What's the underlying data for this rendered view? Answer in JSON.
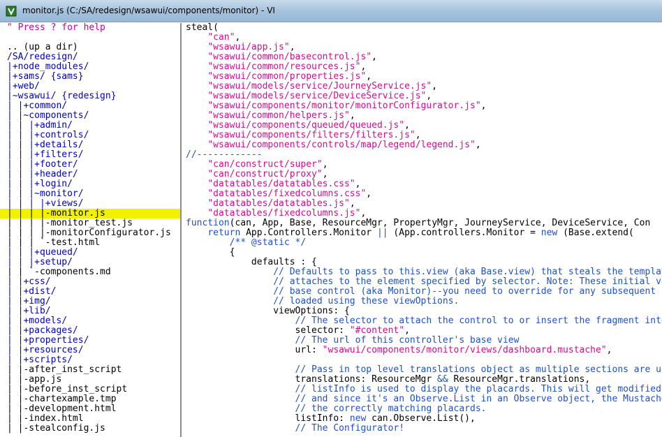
{
  "window": {
    "title": "monitor.js (C:/SA/redesign/wsawui/components/monitor) - VI"
  },
  "file_tree": {
    "lines": [
      {
        "text": "\" Press ? for help",
        "type": "help"
      },
      {
        "text": "",
        "type": "file"
      },
      {
        "text": ".. (up a dir)",
        "type": "file"
      },
      {
        "text": "/SA/redesign/",
        "type": "dir"
      },
      {
        "text": "|+node_modules/",
        "type": "dir"
      },
      {
        "text": "|+sams/ {sams}",
        "type": "dir"
      },
      {
        "text": "|+web/",
        "type": "dir"
      },
      {
        "text": "|~wsawui/ {redesign}",
        "type": "dir"
      },
      {
        "text": "| |+common/",
        "type": "dir"
      },
      {
        "text": "| |~components/",
        "type": "dir"
      },
      {
        "text": "| | |+admin/",
        "type": "dir"
      },
      {
        "text": "| | |+controls/",
        "type": "dir"
      },
      {
        "text": "| | |+details/",
        "type": "dir"
      },
      {
        "text": "| | |+filters/",
        "type": "dir"
      },
      {
        "text": "| | |+footer/",
        "type": "dir"
      },
      {
        "text": "| | |+header/",
        "type": "dir"
      },
      {
        "text": "| | |+login/",
        "type": "dir"
      },
      {
        "text": "| | |~monitor/",
        "type": "dir"
      },
      {
        "text": "| | | |+views/",
        "type": "dir"
      },
      {
        "text": "| | | |-monitor.js",
        "type": "selected"
      },
      {
        "text": "| | | |-monitor_test.js",
        "type": "file"
      },
      {
        "text": "| | | |-monitorConfigurator.js",
        "type": "file"
      },
      {
        "text": "| | | `-test.html",
        "type": "file"
      },
      {
        "text": "| | |+queued/",
        "type": "dir"
      },
      {
        "text": "| | |+setup/",
        "type": "dir"
      },
      {
        "text": "| | `-components.md",
        "type": "file"
      },
      {
        "text": "| |+css/",
        "type": "dir"
      },
      {
        "text": "| |+dist/",
        "type": "dir"
      },
      {
        "text": "| |+img/",
        "type": "dir"
      },
      {
        "text": "| |+lib/",
        "type": "dir"
      },
      {
        "text": "| |+models/",
        "type": "dir"
      },
      {
        "text": "| |+packages/",
        "type": "dir"
      },
      {
        "text": "| |+properties/",
        "type": "dir"
      },
      {
        "text": "| |+resources/",
        "type": "dir"
      },
      {
        "text": "| |+scripts/",
        "type": "dir"
      },
      {
        "text": "| |-after_inst_script",
        "type": "file"
      },
      {
        "text": "| |-app.js",
        "type": "file"
      },
      {
        "text": "| |-before_inst_script",
        "type": "file"
      },
      {
        "text": "| |-chartexample.tmp",
        "type": "file"
      },
      {
        "text": "| |-development.html",
        "type": "file"
      },
      {
        "text": "| |-index.html",
        "type": "file"
      },
      {
        "text": "| |-stealconfig.js",
        "type": "file"
      }
    ]
  },
  "code": {
    "lines": [
      [
        {
          "t": "steal(",
          "c": "text"
        }
      ],
      [
        {
          "t": "    ",
          "c": "text"
        },
        {
          "t": "\"can\"",
          "c": "str"
        },
        {
          "t": ",",
          "c": "text"
        }
      ],
      [
        {
          "t": "    ",
          "c": "text"
        },
        {
          "t": "\"wsawui/app.js\"",
          "c": "str"
        },
        {
          "t": ",",
          "c": "text"
        }
      ],
      [
        {
          "t": "    ",
          "c": "text"
        },
        {
          "t": "\"wsawui/common/basecontrol.js\"",
          "c": "str"
        },
        {
          "t": ",",
          "c": "text"
        }
      ],
      [
        {
          "t": "    ",
          "c": "text"
        },
        {
          "t": "\"wsawui/common/resources.js\"",
          "c": "str"
        },
        {
          "t": ",",
          "c": "text"
        }
      ],
      [
        {
          "t": "    ",
          "c": "text"
        },
        {
          "t": "\"wsawui/common/properties.js\"",
          "c": "str"
        },
        {
          "t": ",",
          "c": "text"
        }
      ],
      [
        {
          "t": "    ",
          "c": "text"
        },
        {
          "t": "\"wsawui/models/service/JourneyService.js\"",
          "c": "str"
        },
        {
          "t": ",",
          "c": "text"
        }
      ],
      [
        {
          "t": "    ",
          "c": "text"
        },
        {
          "t": "\"wsawui/models/service/DeviceService.js\"",
          "c": "str"
        },
        {
          "t": ",",
          "c": "text"
        }
      ],
      [
        {
          "t": "    ",
          "c": "text"
        },
        {
          "t": "\"wsawui/components/monitor/monitorConfigurator.js\"",
          "c": "str"
        },
        {
          "t": ",",
          "c": "text"
        }
      ],
      [
        {
          "t": "    ",
          "c": "text"
        },
        {
          "t": "\"wsawui/common/helpers.js\"",
          "c": "str"
        },
        {
          "t": ",",
          "c": "text"
        }
      ],
      [
        {
          "t": "    ",
          "c": "text"
        },
        {
          "t": "\"wsawui/components/queued/queued.js\"",
          "c": "str"
        },
        {
          "t": ",",
          "c": "text"
        }
      ],
      [
        {
          "t": "    ",
          "c": "text"
        },
        {
          "t": "\"wsawui/components/filters/filters.js\"",
          "c": "str"
        },
        {
          "t": ",",
          "c": "text"
        }
      ],
      [
        {
          "t": "    ",
          "c": "text"
        },
        {
          "t": "\"wsawui/components/controls/map/legend/legend.js\"",
          "c": "str"
        },
        {
          "t": ",",
          "c": "text"
        }
      ],
      [
        {
          "t": "//------------",
          "c": "com"
        }
      ],
      [
        {
          "t": "    ",
          "c": "text"
        },
        {
          "t": "\"can/construct/super\"",
          "c": "str"
        },
        {
          "t": ",",
          "c": "text"
        }
      ],
      [
        {
          "t": "    ",
          "c": "text"
        },
        {
          "t": "\"can/construct/proxy\"",
          "c": "str"
        },
        {
          "t": ",",
          "c": "text"
        }
      ],
      [
        {
          "t": "    ",
          "c": "text"
        },
        {
          "t": "\"datatables/datatables.css\"",
          "c": "str"
        },
        {
          "t": ",",
          "c": "text"
        }
      ],
      [
        {
          "t": "    ",
          "c": "text"
        },
        {
          "t": "\"datatables/fixedcolumns.css\"",
          "c": "str"
        },
        {
          "t": ",",
          "c": "text"
        }
      ],
      [
        {
          "t": "    ",
          "c": "text"
        },
        {
          "t": "\"datatables/datatables.js\"",
          "c": "str"
        },
        {
          "t": ",",
          "c": "text"
        }
      ],
      [
        {
          "t": "    ",
          "c": "text"
        },
        {
          "t": "\"datatables/fixedcolumns.js\"",
          "c": "str"
        },
        {
          "t": ",",
          "c": "text"
        }
      ],
      [
        {
          "t": "function",
          "c": "kw"
        },
        {
          "t": "(can, App, Base, ResourceMgr, PropertyMgr, JourneyService, DeviceService, Con",
          "c": "text"
        }
      ],
      [
        {
          "t": "    ",
          "c": "text"
        },
        {
          "t": "return",
          "c": "kw"
        },
        {
          "t": " App.Controllers.Monitor ",
          "c": "text"
        },
        {
          "t": "||",
          "c": "kw"
        },
        {
          "t": " (App.controllers.Monitor = ",
          "c": "text"
        },
        {
          "t": "new",
          "c": "kw"
        },
        {
          "t": " (Base.extend(",
          "c": "text"
        }
      ],
      [
        {
          "t": "        ",
          "c": "text"
        },
        {
          "t": "/** @static */",
          "c": "com"
        }
      ],
      [
        {
          "t": "        {",
          "c": "text"
        }
      ],
      [
        {
          "t": "            defaults : {",
          "c": "text"
        }
      ],
      [
        {
          "t": "                ",
          "c": "text"
        },
        {
          "t": "// Defaults to pass to this.view (aka Base.view) that steals the template",
          "c": "com"
        }
      ],
      [
        {
          "t": "                ",
          "c": "text"
        },
        {
          "t": "// attaches to the element specified by selector. Note: These initial val",
          "c": "com"
        }
      ],
      [
        {
          "t": "                ",
          "c": "text"
        },
        {
          "t": "// base control (aka Monitor)--you need to override for any subsequent \"s",
          "c": "com"
        }
      ],
      [
        {
          "t": "                ",
          "c": "text"
        },
        {
          "t": "// loaded using these viewOptions.",
          "c": "com"
        }
      ],
      [
        {
          "t": "                viewOptions: {",
          "c": "text"
        }
      ],
      [
        {
          "t": "                    ",
          "c": "text"
        },
        {
          "t": "// The selector to attach the control to or insert the fragment into",
          "c": "com"
        }
      ],
      [
        {
          "t": "                    selector: ",
          "c": "text"
        },
        {
          "t": "\"#content\"",
          "c": "str"
        },
        {
          "t": ",",
          "c": "text"
        }
      ],
      [
        {
          "t": "                    ",
          "c": "text"
        },
        {
          "t": "// The url of this controller's base view",
          "c": "com"
        }
      ],
      [
        {
          "t": "                    url: ",
          "c": "text"
        },
        {
          "t": "\"wsawui/components/monitor/views/dashboard.mustache\"",
          "c": "str"
        },
        {
          "t": ",",
          "c": "text"
        }
      ],
      [
        {
          "t": "",
          "c": "text"
        }
      ],
      [
        {
          "t": "                    ",
          "c": "text"
        },
        {
          "t": "// Pass in top level translations object as multiple sections are used",
          "c": "com"
        }
      ],
      [
        {
          "t": "                    translations: ResourceMgr ",
          "c": "text"
        },
        {
          "t": "&&",
          "c": "kw"
        },
        {
          "t": " ResourceMgr.translations,",
          "c": "text"
        }
      ],
      [
        {
          "t": "                    ",
          "c": "text"
        },
        {
          "t": "// listInfo is used to display the placards. This will get modified by",
          "c": "com"
        }
      ],
      [
        {
          "t": "                    ",
          "c": "text"
        },
        {
          "t": "// and since it's an Observe.List in an Observe object, the Mustache t",
          "c": "com"
        }
      ],
      [
        {
          "t": "                    ",
          "c": "text"
        },
        {
          "t": "// the correctly matching placards.",
          "c": "com"
        }
      ],
      [
        {
          "t": "                    listInfo: ",
          "c": "text"
        },
        {
          "t": "new",
          "c": "kw"
        },
        {
          "t": " can.Observe.List(),",
          "c": "text"
        }
      ],
      [
        {
          "t": "                    ",
          "c": "text"
        },
        {
          "t": "// The Configurator!",
          "c": "com"
        }
      ]
    ]
  },
  "colors": {
    "string": "#d50e8a",
    "comment": "#2050c8",
    "directory": "#0000c0",
    "selection": "#f2f200"
  }
}
